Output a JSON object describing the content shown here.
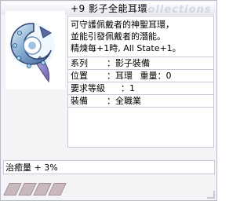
{
  "window": {
    "title": "+9 影子全能耳環",
    "watermark": "Collections"
  },
  "item": {
    "icon": "shadow-earring-icon",
    "description": [
      "可守護佩戴者的神聖耳環，",
      "並能引發佩戴者的潛能。",
      "精煉每+1時, All State+1。"
    ],
    "rows": [
      {
        "label": "系列",
        "value": "影子裝備"
      },
      {
        "label": "位置",
        "value": "耳環"
      },
      {
        "label": "重量",
        "value": "0"
      },
      {
        "label": "要求等級",
        "value": "1"
      },
      {
        "label": "裝備",
        "value": "全職業"
      }
    ]
  },
  "option": {
    "text": "治癒量 + 3%"
  },
  "cards": {
    "slots": 4
  },
  "colors": {
    "border": "#c6cad6",
    "background": "#f4f4f7",
    "card_slot": "#c9b9bf"
  }
}
